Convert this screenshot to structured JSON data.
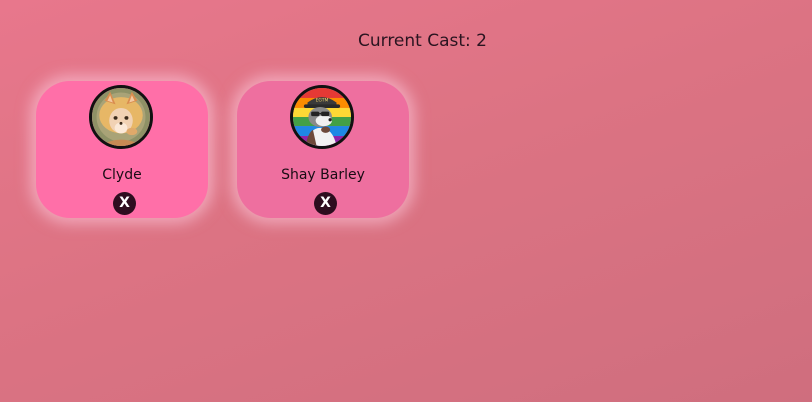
{
  "header": {
    "cast_count": "Current Cast: 2"
  },
  "cast": [
    {
      "name": "Clyde",
      "avatar_icon": "fox-avatar-icon",
      "remove_label": "X",
      "card_color": "#ff6fa8"
    },
    {
      "name": "Shay Barley",
      "avatar_icon": "otter-pride-avatar-icon",
      "remove_label": "X",
      "card_color": "#ee6f9f"
    }
  ],
  "colors": {
    "background": "#dc7383",
    "remove_button": "#2e0d1f"
  }
}
